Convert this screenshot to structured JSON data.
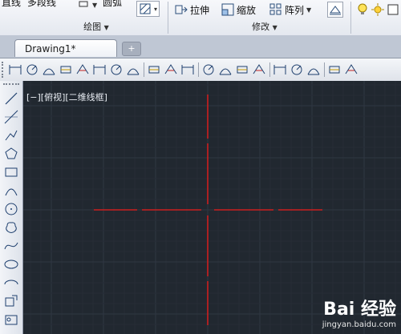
{
  "ribbon": {
    "top_left_partial_1": "直线",
    "top_left_partial_2": "多段线",
    "top_left_partial_3": "圆弧",
    "draw_panel_label": "绘图",
    "stretch_label": "拉伸",
    "scale_label": "缩放",
    "array_label": "阵列",
    "modify_panel_label": "修改"
  },
  "tabs": {
    "active_tab": "Drawing1*",
    "new_tab_glyph": "+"
  },
  "viewport": {
    "label": "[−][俯视][二维线框]",
    "background_color": "#212830",
    "grid_major_color": "#2f3742",
    "grid_minor_color": "#262d36",
    "axis_color": "#cc1f1f"
  },
  "watermark": {
    "logo_text": "Bai 经验",
    "url": "jingyan.baidu.com"
  },
  "icons": {
    "toolbar": [
      "linear-dim-icon",
      "aligned-dim-icon",
      "arc-length-icon",
      "ordinate-dim-icon",
      "radius-dim-icon",
      "jogged-dim-icon",
      "diameter-dim-icon",
      "angular-dim-icon",
      "quick-dim-icon",
      "baseline-dim-icon",
      "continue-dim-icon",
      "space-dim-icon",
      "break-dim-icon",
      "tolerance-icon",
      "center-mark-icon",
      "inspect-icon",
      "jogged-linear-icon",
      "dim-edit-icon",
      "dim-text-edit-icon",
      "dim-update-icon"
    ],
    "left": [
      "line-icon",
      "construction-line-icon",
      "polyline-icon",
      "polygon-icon",
      "rectangle-icon",
      "arc-icon",
      "circle-icon",
      "revision-cloud-icon",
      "spline-icon",
      "ellipse-icon",
      "ellipse-arc-icon",
      "insert-block-icon",
      "make-block-icon"
    ]
  }
}
